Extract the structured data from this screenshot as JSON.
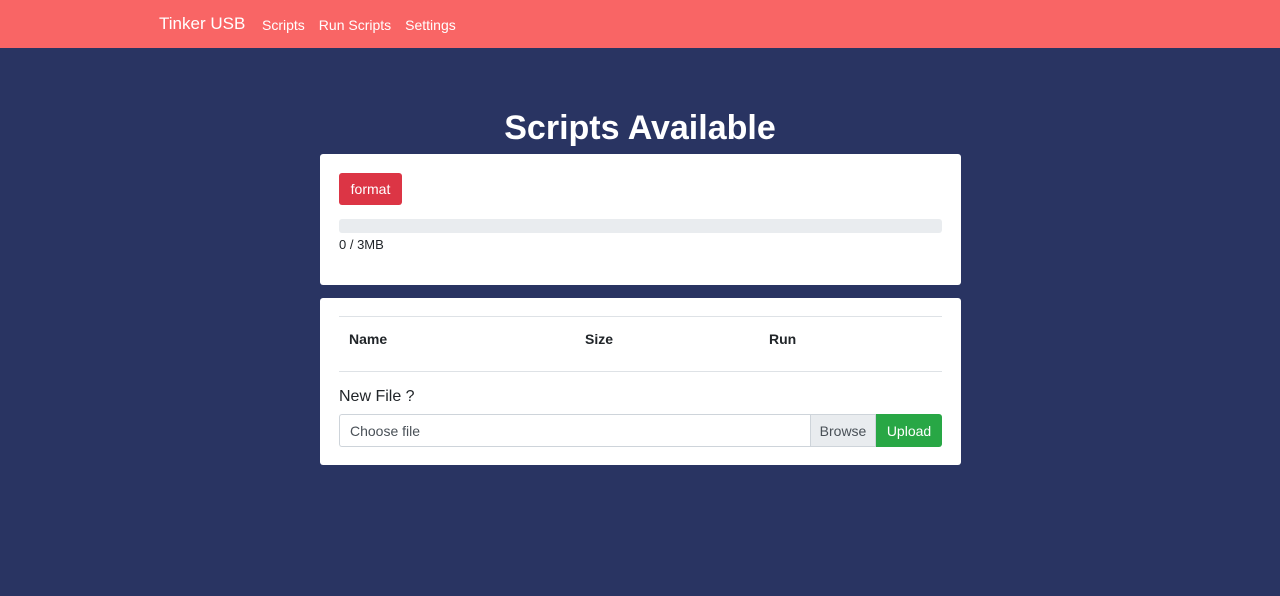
{
  "navbar": {
    "brand": "Tinker USB",
    "links": [
      {
        "label": "Scripts"
      },
      {
        "label": "Run Scripts"
      },
      {
        "label": "Settings"
      }
    ],
    "color": "#f96565"
  },
  "page": {
    "title": "Scripts Available",
    "background": "#293462"
  },
  "storage": {
    "format_label": "format",
    "usage_text": "0 / 3MB",
    "used_fraction": 0
  },
  "scripts_table": {
    "columns": [
      "Name",
      "Size",
      "Run"
    ],
    "rows": []
  },
  "upload": {
    "heading": "New File ?",
    "placeholder": "Choose file",
    "browse_label": "Browse",
    "upload_label": "Upload"
  }
}
